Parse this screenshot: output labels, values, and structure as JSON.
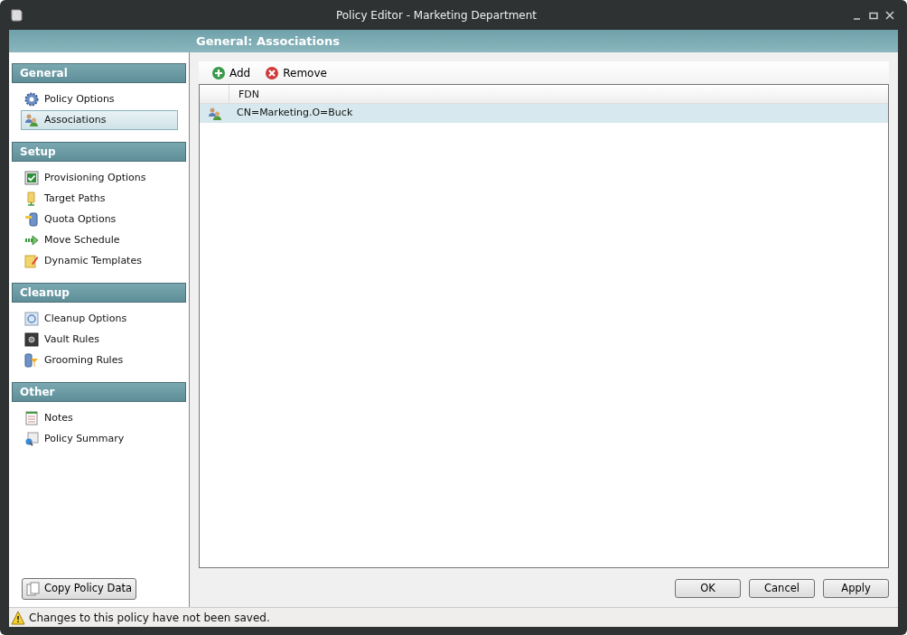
{
  "window": {
    "title": "Policy Editor - Marketing Department"
  },
  "header": {
    "title": "General: Associations"
  },
  "sidebar": {
    "sections": [
      {
        "title": "General",
        "items": [
          {
            "label": "Policy Options",
            "selected": false
          },
          {
            "label": "Associations",
            "selected": true
          }
        ]
      },
      {
        "title": "Setup",
        "items": [
          {
            "label": "Provisioning Options",
            "selected": false
          },
          {
            "label": "Target Paths",
            "selected": false
          },
          {
            "label": "Quota Options",
            "selected": false
          },
          {
            "label": "Move Schedule",
            "selected": false
          },
          {
            "label": "Dynamic Templates",
            "selected": false
          }
        ]
      },
      {
        "title": "Cleanup",
        "items": [
          {
            "label": "Cleanup Options",
            "selected": false
          },
          {
            "label": "Vault Rules",
            "selected": false
          },
          {
            "label": "Grooming Rules",
            "selected": false
          }
        ]
      },
      {
        "title": "Other",
        "items": [
          {
            "label": "Notes",
            "selected": false
          },
          {
            "label": "Policy Summary",
            "selected": false
          }
        ]
      }
    ],
    "copy_button": "Copy Policy Data"
  },
  "toolbar": {
    "buttons": [
      {
        "label": "Add",
        "kind": "add"
      },
      {
        "label": "Remove",
        "kind": "remove"
      }
    ]
  },
  "table": {
    "columns": [
      "FDN"
    ],
    "rows": [
      {
        "fdn": "CN=Marketing.O=Buck",
        "selected": true
      }
    ]
  },
  "buttons": [
    "OK",
    "Cancel",
    "Apply"
  ],
  "status_bar": {
    "message": "Changes to this policy have not been saved."
  }
}
